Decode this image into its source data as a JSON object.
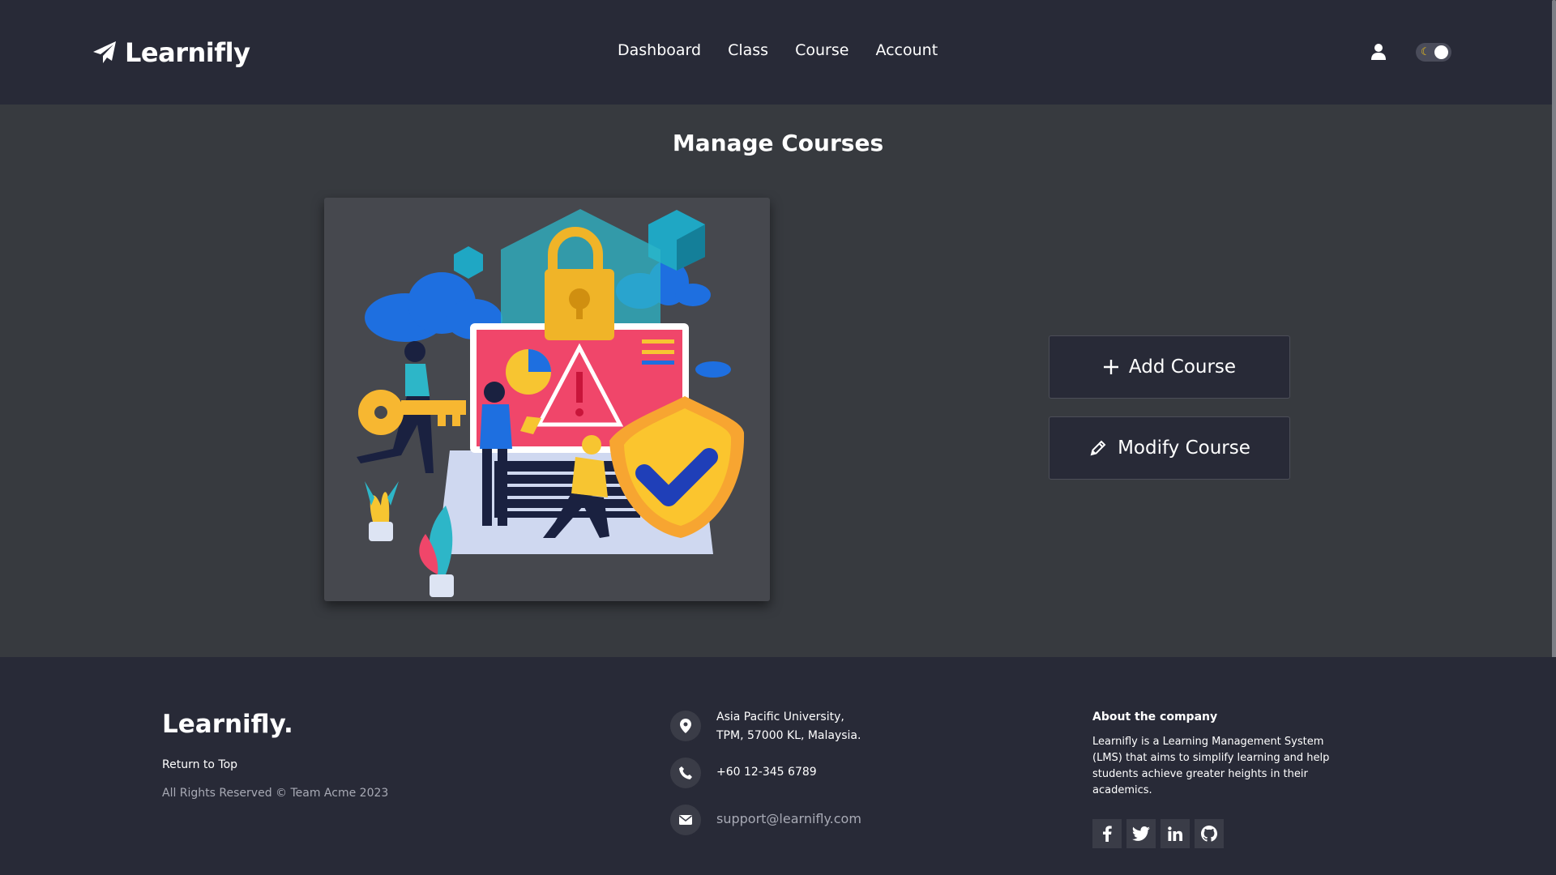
{
  "brand": {
    "name": "Learnifly",
    "footer_name": "Learnifly."
  },
  "nav": {
    "items": [
      "Dashboard",
      "Class",
      "Course",
      "Account"
    ]
  },
  "page": {
    "title": "Manage Courses"
  },
  "actions": {
    "add_label": "Add Course",
    "modify_label": "Modify Course"
  },
  "footer": {
    "return_top": "Return to Top",
    "copyright": "All Rights Reserved © Team Acme 2023",
    "address_line1": "Asia Pacific University,",
    "address_line2": "TPM, 57000 KL, Malaysia.",
    "phone": "+60 12-345 6789",
    "email": "support@learnifly.com",
    "about_title": "About the company",
    "about_text": "Learnifly is a Learning Management System (LMS) that aims to simplify learning and help students achieve greater heights in their academics."
  },
  "icons": {
    "brand": "paper-plane-icon",
    "user": "user-icon",
    "theme": "moon-icon",
    "add": "plus-icon",
    "modify": "pencil-icon",
    "location": "location-pin-icon",
    "phone": "phone-icon",
    "email": "envelope-icon",
    "social": [
      "facebook-icon",
      "twitter-icon",
      "linkedin-icon",
      "github-icon"
    ]
  },
  "colors": {
    "header_bg": "#282a37",
    "page_bg": "#373a3f",
    "footer_bg": "#282a37",
    "muted_text": "#a8aab5",
    "toggle_moon": "#f5c518"
  }
}
